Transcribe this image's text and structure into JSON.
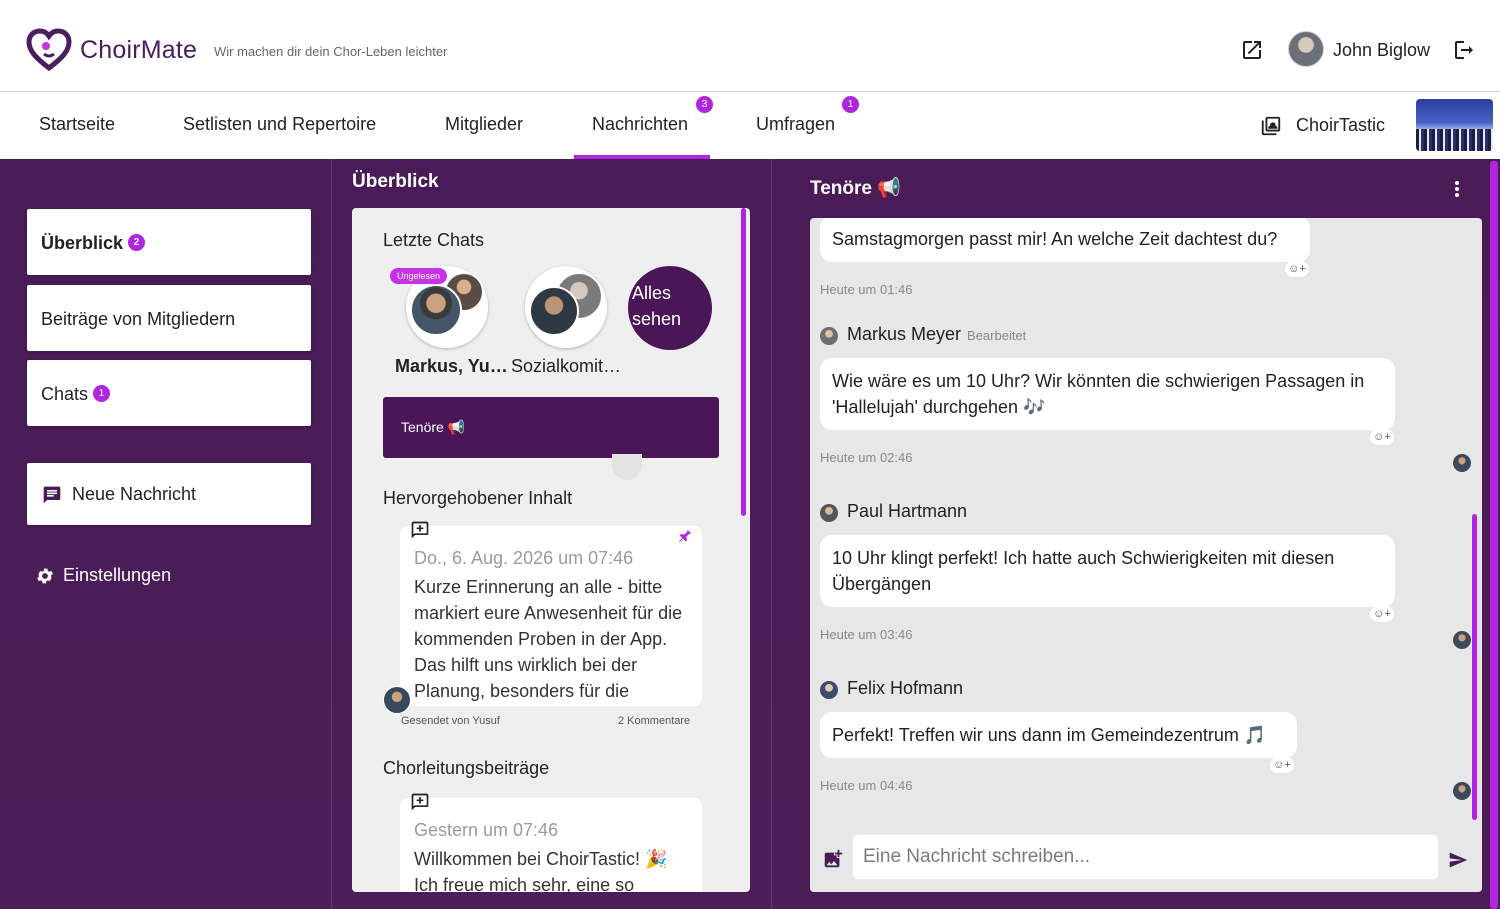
{
  "header": {
    "brand": "ChoirMate",
    "tagline": "Wir machen dir dein Chor-Leben leichter",
    "user_name": "John Biglow"
  },
  "nav": {
    "items": [
      {
        "label": "Startseite"
      },
      {
        "label": "Setlisten und Repertoire"
      },
      {
        "label": "Mitglieder"
      },
      {
        "label": "Nachrichten",
        "badge": "3",
        "active": true
      },
      {
        "label": "Umfragen",
        "badge": "1"
      }
    ],
    "group_name": "ChoirTastic"
  },
  "sidebar": {
    "items": [
      {
        "label": "Überblick",
        "badge": "2"
      },
      {
        "label": "Beiträge von Mitgliedern"
      },
      {
        "label": "Chats",
        "badge": "1"
      }
    ],
    "new_message": "Neue Nachricht",
    "settings": "Einstellungen"
  },
  "overview": {
    "title": "Überblick",
    "recent_chats_title": "Letzte Chats",
    "unread_tag": "Ungelesen",
    "chats": [
      {
        "label": "Markus, Yu…"
      },
      {
        "label": "Sozialkomit…"
      }
    ],
    "see_all": "Alles sehen",
    "active_chat": "Tenöre 📢",
    "highlighted_title": "Hervorgehobener Inhalt",
    "highlighted_post": {
      "date": "Do., 6. Aug. 2026 um 07:46",
      "text": "Kurze Erinnerung an alle - bitte markiert eure Anwesenheit für die kommenden Proben in der App. Das hilft uns wirklich bei der Planung, besonders für die",
      "sender": "Gesendet von Yusuf",
      "comments": "2 Kommentare"
    },
    "leadership_title": "Chorleitungsbeiträge",
    "leadership_post": {
      "date": "Gestern um 07:46",
      "text": "Willkommen bei ChoirTastic! 🎉 Ich freue mich sehr, eine so"
    }
  },
  "chat": {
    "title": "Tenöre 📢",
    "reaction_label": "☺+",
    "messages": [
      {
        "text": "Samstagmorgen passt mir! An welche Zeit dachtest du?",
        "time": "Heute um 01:46"
      },
      {
        "sender": "Markus Meyer",
        "edited": "Bearbeitet",
        "text": "Wie wäre es um 10 Uhr? Wir könnten die schwierigen Passagen in 'Hallelujah' durchgehen 🎶",
        "time": "Heute um 02:46"
      },
      {
        "sender": "Paul Hartmann",
        "text": "10 Uhr klingt perfekt! Ich hatte auch Schwierigkeiten mit diesen Übergängen",
        "time": "Heute um 03:46"
      },
      {
        "sender": "Felix Hofmann",
        "text": "Perfekt! Treffen wir uns dann im Gemeindezentrum 🎵",
        "time": "Heute um 04:46"
      }
    ],
    "input_placeholder": "Eine Nachricht schreiben..."
  },
  "colors": {
    "accent": "#b026e0",
    "primary_dark": "#4a1c57",
    "brand": "#4a1d5e"
  }
}
